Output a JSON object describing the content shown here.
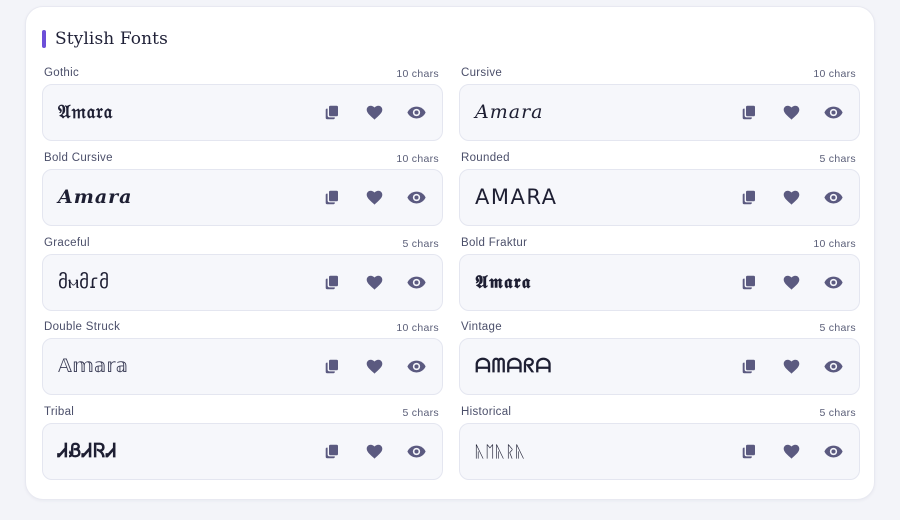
{
  "section": {
    "title": "Stylish Fonts",
    "accent": "#6c4fd8"
  },
  "icon_color": "#5b5a80",
  "fonts": [
    {
      "name": "Gothic",
      "count": "10 chars",
      "sample": "𝔄𝔪𝔞𝔯𝔞"
    },
    {
      "name": "Cursive",
      "count": "10 chars",
      "sample": "𝐴𝑚𝑎𝑟𝑎"
    },
    {
      "name": "Bold Cursive",
      "count": "10 chars",
      "sample": "𝑨𝒎𝒂𝒓𝒂"
    },
    {
      "name": "Rounded",
      "count": "5 chars",
      "sample": "AMARA"
    },
    {
      "name": "Graceful",
      "count": "5 chars",
      "sample": "მⲙმɾმ"
    },
    {
      "name": "Bold Fraktur",
      "count": "10 chars",
      "sample": "𝕬𝖒𝖆𝖗𝖆"
    },
    {
      "name": "Double Struck",
      "count": "10 chars",
      "sample": "𝔸𝕞𝕒𝕣𝕒"
    },
    {
      "name": "Vintage",
      "count": "5 chars",
      "sample": "ᗩᗰᗩᖇᗩ"
    },
    {
      "name": "Tribal",
      "count": "5 chars",
      "sample": "ᏗᏰᏗᏒᏗ"
    },
    {
      "name": "Historical",
      "count": "5 chars",
      "sample": "ᚣᛖᚣᚱᚣ"
    }
  ],
  "actions": [
    "copy-icon",
    "heart-icon",
    "eye-icon"
  ]
}
